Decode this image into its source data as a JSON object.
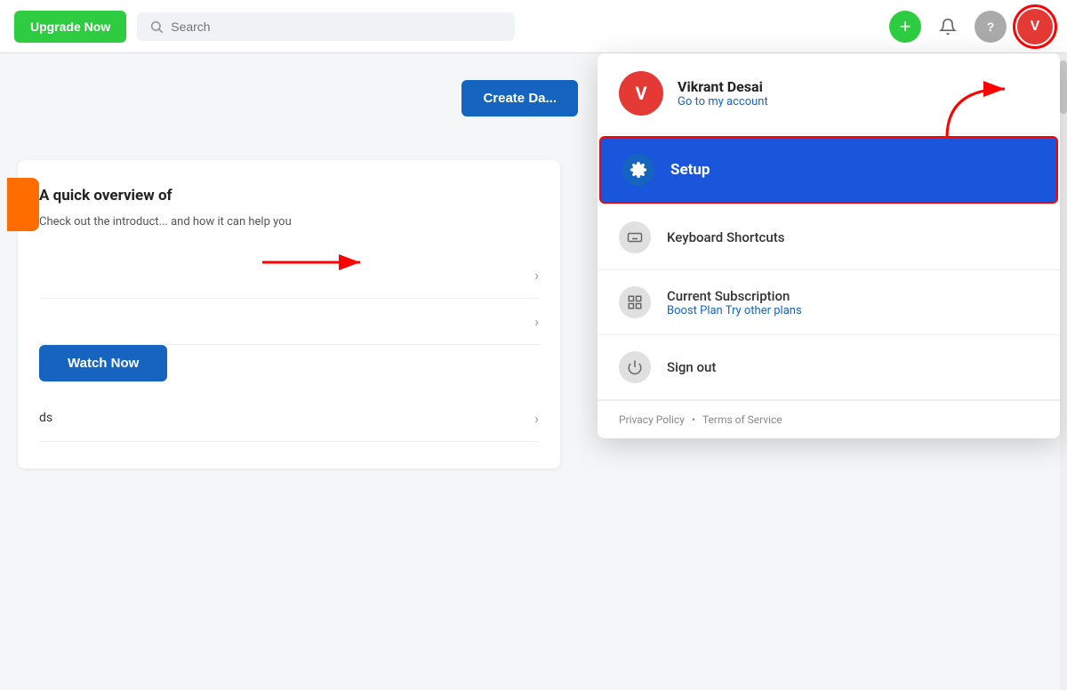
{
  "nav": {
    "upgrade_label": "Upgrade Now",
    "search_placeholder": "Search",
    "avatar_letter": "V",
    "plus_icon": "+",
    "bell_icon": "🔔",
    "help_icon": "?"
  },
  "dropdown": {
    "user_name": "Vikrant Desai",
    "user_link": "Go to my account",
    "avatar_letter": "V",
    "items": [
      {
        "id": "setup",
        "label": "Setup",
        "icon_type": "blue",
        "icon_symbol": "⚙",
        "active": true
      },
      {
        "id": "keyboard",
        "label": "Keyboard Shortcuts",
        "icon_type": "gray",
        "icon_symbol": "☰",
        "active": false
      },
      {
        "id": "subscription",
        "label": "Current Subscription",
        "sublabel_main": "Boost Plan",
        "sublabel_link": "Try other plans",
        "icon_type": "gray",
        "icon_symbol": "▦",
        "active": false
      },
      {
        "id": "signout",
        "label": "Sign out",
        "icon_type": "gray",
        "icon_symbol": "⏻",
        "active": false
      }
    ],
    "footer": {
      "privacy": "Privacy Policy",
      "dot": "•",
      "terms": "Terms of Service"
    }
  },
  "main": {
    "create_dashboard_label": "Create Da...",
    "overview_title": "A quick overview of",
    "overview_desc": "Check out the introduct...\nand how it can help you",
    "watch_now_label": "Watch Now",
    "bottom_label": "ds"
  }
}
